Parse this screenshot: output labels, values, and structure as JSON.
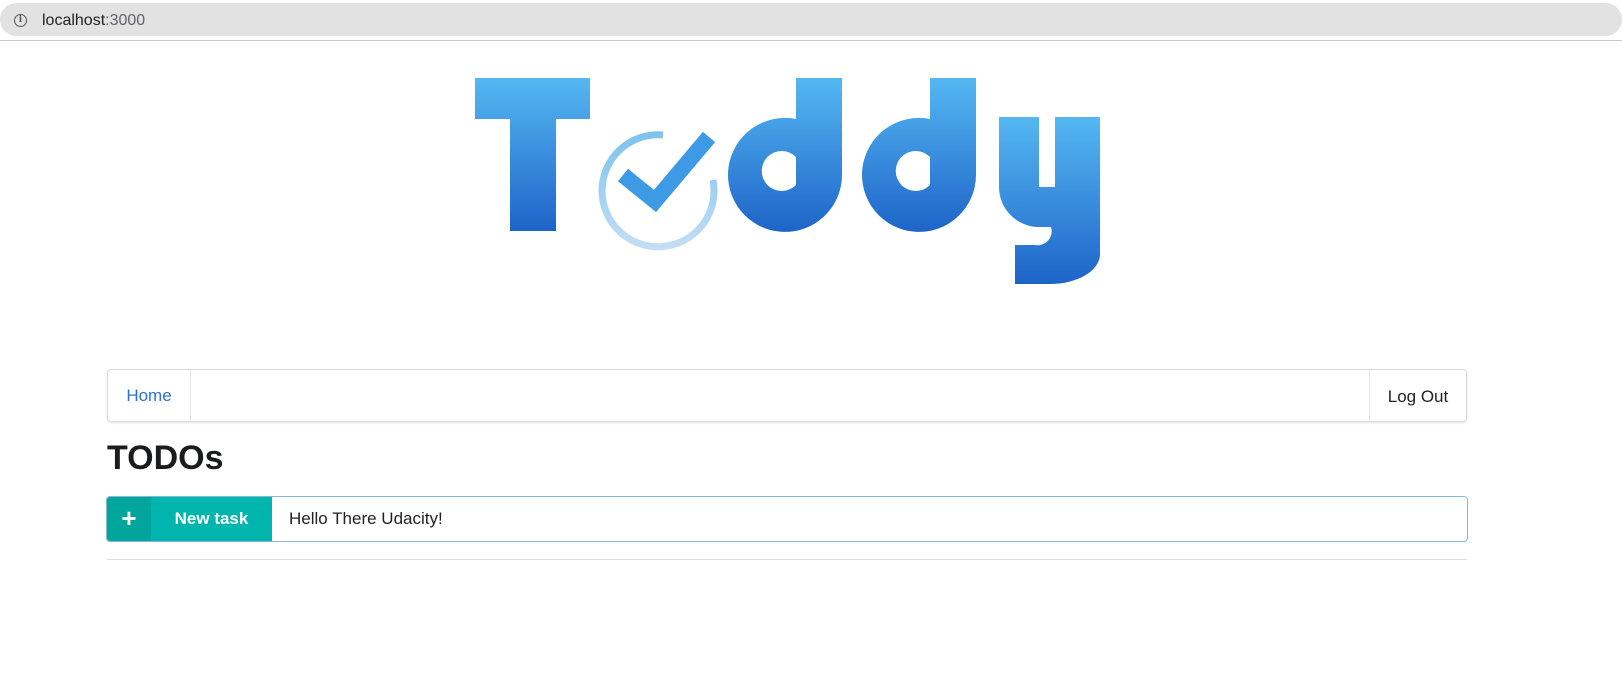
{
  "browser": {
    "url_host": "localhost",
    "url_port": ":3000"
  },
  "logo": {
    "text": "Toddy",
    "gradient_top": "#55b8f2",
    "gradient_bottom": "#1e64c8"
  },
  "nav": {
    "home_label": "Home",
    "logout_label": "Log Out"
  },
  "page": {
    "title": "TODOs"
  },
  "new_task": {
    "icon": "plus-icon",
    "button_label": "New task",
    "input_value": "Hello There Udacity!"
  },
  "colors": {
    "accent_teal": "#00b5ad",
    "link_blue": "#2f72c4"
  }
}
